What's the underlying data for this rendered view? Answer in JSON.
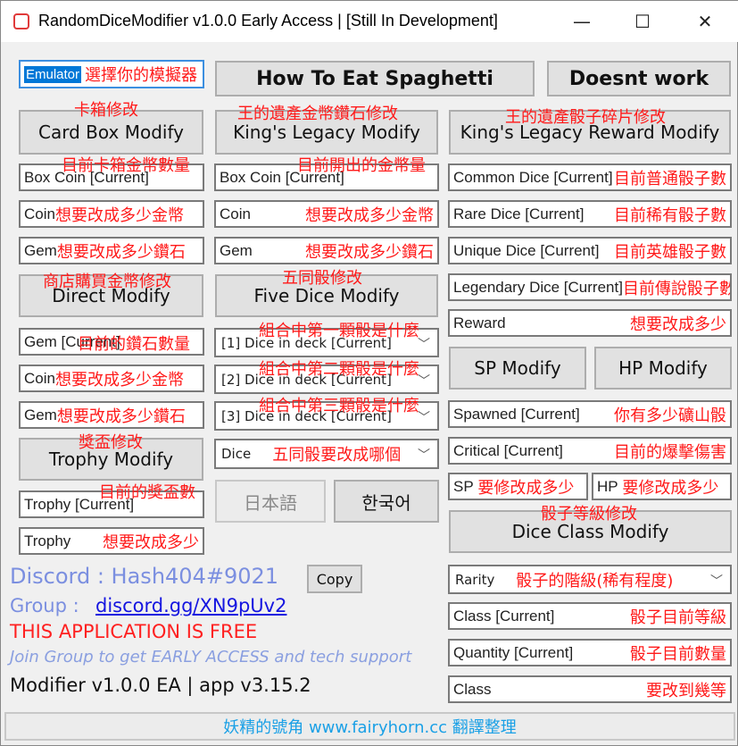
{
  "window": {
    "title": "RandomDiceModifier v1.0.0 Early Access | [Still In Development]",
    "minimize": "—",
    "maximize": "☐",
    "close": "✕"
  },
  "emulator": {
    "value": "Emulator",
    "note": "選擇你的模擬器"
  },
  "buttons": {
    "spaghetti": "How To Eat Spaghetti",
    "doesnt_work": "Doesnt work",
    "card_box": "Card Box Modify",
    "kings_legacy": "King's Legacy Modify",
    "kings_reward": "King's Legacy Reward Modify",
    "direct": "Direct Modify",
    "five_dice": "Five Dice Modify",
    "trophy": "Trophy Modify",
    "japanese": "日本語",
    "korean": "한국어",
    "sp": "SP Modify",
    "hp": "HP Modify",
    "dice_class": "Dice Class Modify",
    "copy": "Copy"
  },
  "notes": {
    "card_box": "卡箱修改",
    "kings_legacy": "王的遺產金幣鑽石修改",
    "kings_reward": "王的遺產骰子碎片修改",
    "box_coin_left": "目前卡箱金幣數量",
    "box_coin_mid": "目前開出的金幣量",
    "direct": "商店購買金幣修改",
    "five_dice": "五同骰修改",
    "dice1": "組合中第一顆骰是什麼",
    "dice2": "組合中第二顆骰是什麼",
    "dice3": "組合中第三顆骰是什麼",
    "trophy": "獎盃修改",
    "trophy_current": "目前的獎盃數",
    "dice_class": "骰子等級修改"
  },
  "left_fields": [
    {
      "label": "Box Coin [Current]",
      "note": ""
    },
    {
      "label": "Coin ",
      "note": "想要改成多少金幣"
    },
    {
      "label": "Gem",
      "note": "想要改成多少鑽石"
    },
    {
      "label": "Gem [Current]",
      "note": "目前的鑽石數量"
    },
    {
      "label": "Coin ",
      "note": "想要改成多少金幣"
    },
    {
      "label": "Gem",
      "note": "想要改成多少鑽石"
    },
    {
      "label": "Trophy [Current]",
      "note": ""
    },
    {
      "label": "Trophy",
      "note": "想要改成多少"
    }
  ],
  "mid_fields": [
    {
      "label": "Box Coin [Current]",
      "note": ""
    },
    {
      "label": "Coin",
      "note": "想要改成多少金幣"
    },
    {
      "label": "Gem",
      "note": "想要改成多少鑽石"
    }
  ],
  "dice_dropdowns": [
    "[1] Dice in deck [Current]",
    "[2] Dice in deck [Current]",
    "[3] Dice in deck [Current]"
  ],
  "dice_select": {
    "value": "Dice",
    "note": "五同骰要改成哪個"
  },
  "right_fields": [
    {
      "label": "Common Dice [Current]",
      "note": "目前普通骰子數"
    },
    {
      "label": "Rare Dice [Current]",
      "note": "目前稀有骰子數"
    },
    {
      "label": "Unique Dice [Current]",
      "note": "目前英雄骰子數"
    },
    {
      "label": "Legendary Dice [Current]",
      "note": "目前傳說骰子數"
    },
    {
      "label": "Reward",
      "note": "想要改成多少"
    },
    {
      "label": "Spawned [Current]",
      "note": "你有多少礦山骰"
    },
    {
      "label": "Critical [Current]",
      "note": "目前的爆擊傷害"
    }
  ],
  "sp_field": {
    "label": "SP",
    "note": "要修改成多少"
  },
  "hp_field": {
    "label": "HP",
    "note": "要修改成多少"
  },
  "rarity": {
    "value": "Rarity",
    "note": "骰子的階級(稀有程度)"
  },
  "class_fields": [
    {
      "label": "Class [Current]",
      "note": "骰子目前等級"
    },
    {
      "label": "Quantity [Current]",
      "note": "骰子目前數量"
    },
    {
      "label": "Class",
      "note": "要改到幾等"
    }
  ],
  "info": {
    "discord": "Discord : Hash404#9021",
    "group_label": "Group :",
    "group_link": "discord.gg/XN9pUv2",
    "free": "THIS APPLICATION IS FREE",
    "join": "Join Group to get EARLY ACCESS and tech support",
    "version": "Modifier v1.0.0 EA | app v3.15.2"
  },
  "status": "妖精的號角 www.fairyhorn.cc 翻譯整理"
}
